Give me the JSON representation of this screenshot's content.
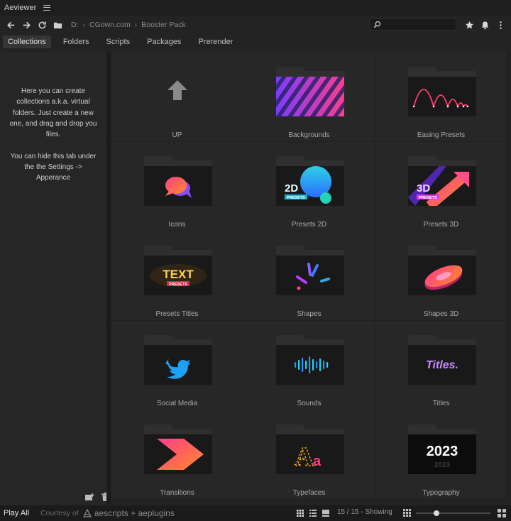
{
  "app": {
    "title": "Aeviewer"
  },
  "breadcrumb": [
    "D:",
    "CGown.com",
    "Booster Pack"
  ],
  "search": {
    "placeholder": "",
    "value": ""
  },
  "tabs": [
    "Collections",
    "Folders",
    "Scripts",
    "Packages",
    "Prerender"
  ],
  "active_tab": "Collections",
  "sidebar": {
    "help_text": "Here you can create collections a.k.a. virtual folders. Just create a new one, and drag and drop you files.\n\nYou can hide this tab under the the Settings -> Apperance"
  },
  "grid": {
    "items": [
      {
        "label": "UP",
        "icon": "up-arrow-icon"
      },
      {
        "label": "Backgrounds",
        "thumb": "stripes"
      },
      {
        "label": "Easing Presets",
        "thumb": "bounce"
      },
      {
        "label": "Icons",
        "thumb": "chat-bubbles"
      },
      {
        "label": "Presets 2D",
        "thumb": "2d",
        "badge_title": "2D",
        "badge_sub": "PRESETS"
      },
      {
        "label": "Presets 3D",
        "thumb": "3d",
        "badge_title": "3D",
        "badge_sub": "PRESETS"
      },
      {
        "label": "Presets Titles",
        "thumb": "text",
        "badge_title": "TEXT",
        "badge_sub": "PRESETS"
      },
      {
        "label": "Shapes",
        "thumb": "burst"
      },
      {
        "label": "Shapes 3D",
        "thumb": "ring"
      },
      {
        "label": "Social Media",
        "thumb": "twitter-bird"
      },
      {
        "label": "Sounds",
        "thumb": "soundwave"
      },
      {
        "label": "Titles",
        "thumb": "titles",
        "badge_title": "Titles."
      },
      {
        "label": "Transitions",
        "thumb": "chevron"
      },
      {
        "label": "Typefaces",
        "thumb": "type",
        "badge_title": "Aa"
      },
      {
        "label": "Typography",
        "thumb": "year",
        "badge_title": "2023"
      }
    ]
  },
  "status": {
    "play_all": "Play All",
    "courtesy_prefix": "Courtesy of",
    "courtesy_brand": "aescripts + aeplugins",
    "count_text": "15 / 15 - Showing",
    "zoom_fraction": 0.28
  },
  "colors": {
    "accent_pink": "#ff3d8a",
    "accent_orange": "#ff8a2a",
    "accent_cyan": "#2fd0e6",
    "accent_purple": "#a04bff"
  }
}
